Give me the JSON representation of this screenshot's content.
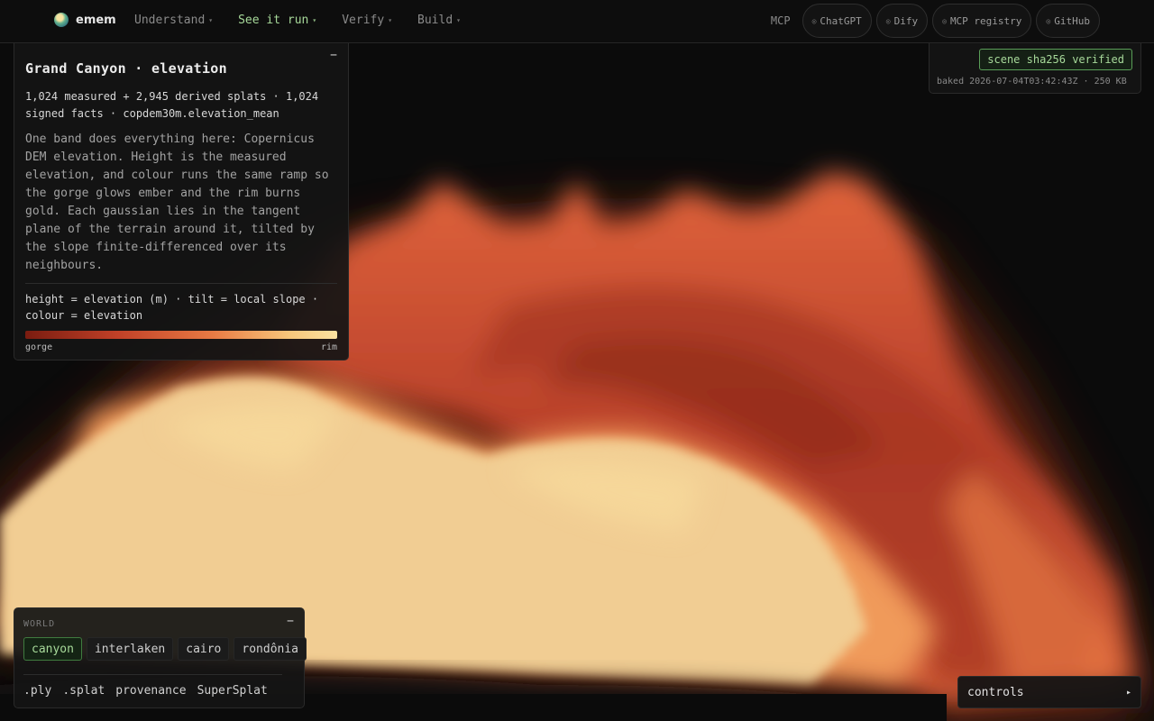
{
  "nav": {
    "brand": "emem",
    "menu": [
      {
        "label": "Understand",
        "active": false
      },
      {
        "label": "See it run",
        "active": true
      },
      {
        "label": "Verify",
        "active": false
      },
      {
        "label": "Build",
        "active": false
      }
    ],
    "mcp_label": "MCP",
    "pills": [
      "ChatGPT",
      "Dify",
      "MCP registry",
      "GitHub"
    ]
  },
  "info": {
    "collapse": "−",
    "title": "Grand Canyon · elevation",
    "stats": "1,024 measured + 2,945 derived splats · 1,024 signed facts · copdem30m.elevation_mean",
    "description": "One band does everything here: Copernicus DEM elevation. Height is the measured elevation, and colour runs the same ramp so the gorge glows ember and the rim burns gold. Each gaussian lies in the tangent plane of the terrain around it, tilted by the slope finite-differenced over its neighbours.",
    "legend": "height = elevation (m) · tilt = local slope · colour = elevation",
    "ramp_low": "gorge",
    "ramp_high": "rim"
  },
  "verify": {
    "badge": "scene sha256 verified",
    "meta": "baked 2026-07-04T03:42:43Z · 250 KB"
  },
  "world": {
    "label": "WORLD",
    "collapse": "−",
    "tabs": [
      {
        "label": "canyon",
        "active": true
      },
      {
        "label": "interlaken",
        "active": false
      },
      {
        "label": "cairo",
        "active": false
      },
      {
        "label": "rondônia",
        "active": false
      }
    ],
    "links": [
      ".ply",
      ".splat",
      "provenance",
      "SuperSplat"
    ]
  },
  "controls": {
    "label": "controls",
    "arrow": "▸"
  },
  "colors": {
    "accent": "#a7d99a",
    "gorge": "#7a1c10",
    "mid": "#e87a44",
    "rim": "#fbe1a0"
  }
}
